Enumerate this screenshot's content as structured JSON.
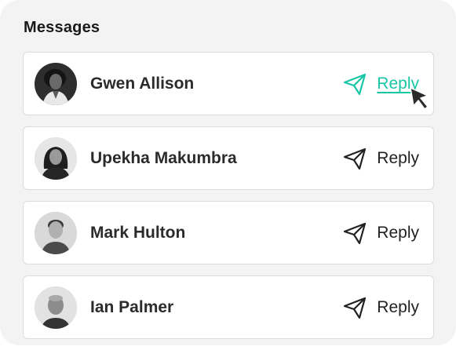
{
  "panel": {
    "title": "Messages"
  },
  "colors": {
    "accent": "#19c6a6",
    "text": "#222222"
  },
  "messages": [
    {
      "name": "Gwen Allison",
      "action": "Reply",
      "icon": "paper-plane-icon",
      "state": "hover"
    },
    {
      "name": "Upekha Makumbra",
      "action": "Reply",
      "icon": "paper-plane-icon",
      "state": "default"
    },
    {
      "name": "Mark Hulton",
      "action": "Reply",
      "icon": "paper-plane-icon",
      "state": "default"
    },
    {
      "name": "Ian Palmer",
      "action": "Reply",
      "icon": "paper-plane-icon",
      "state": "default"
    }
  ]
}
